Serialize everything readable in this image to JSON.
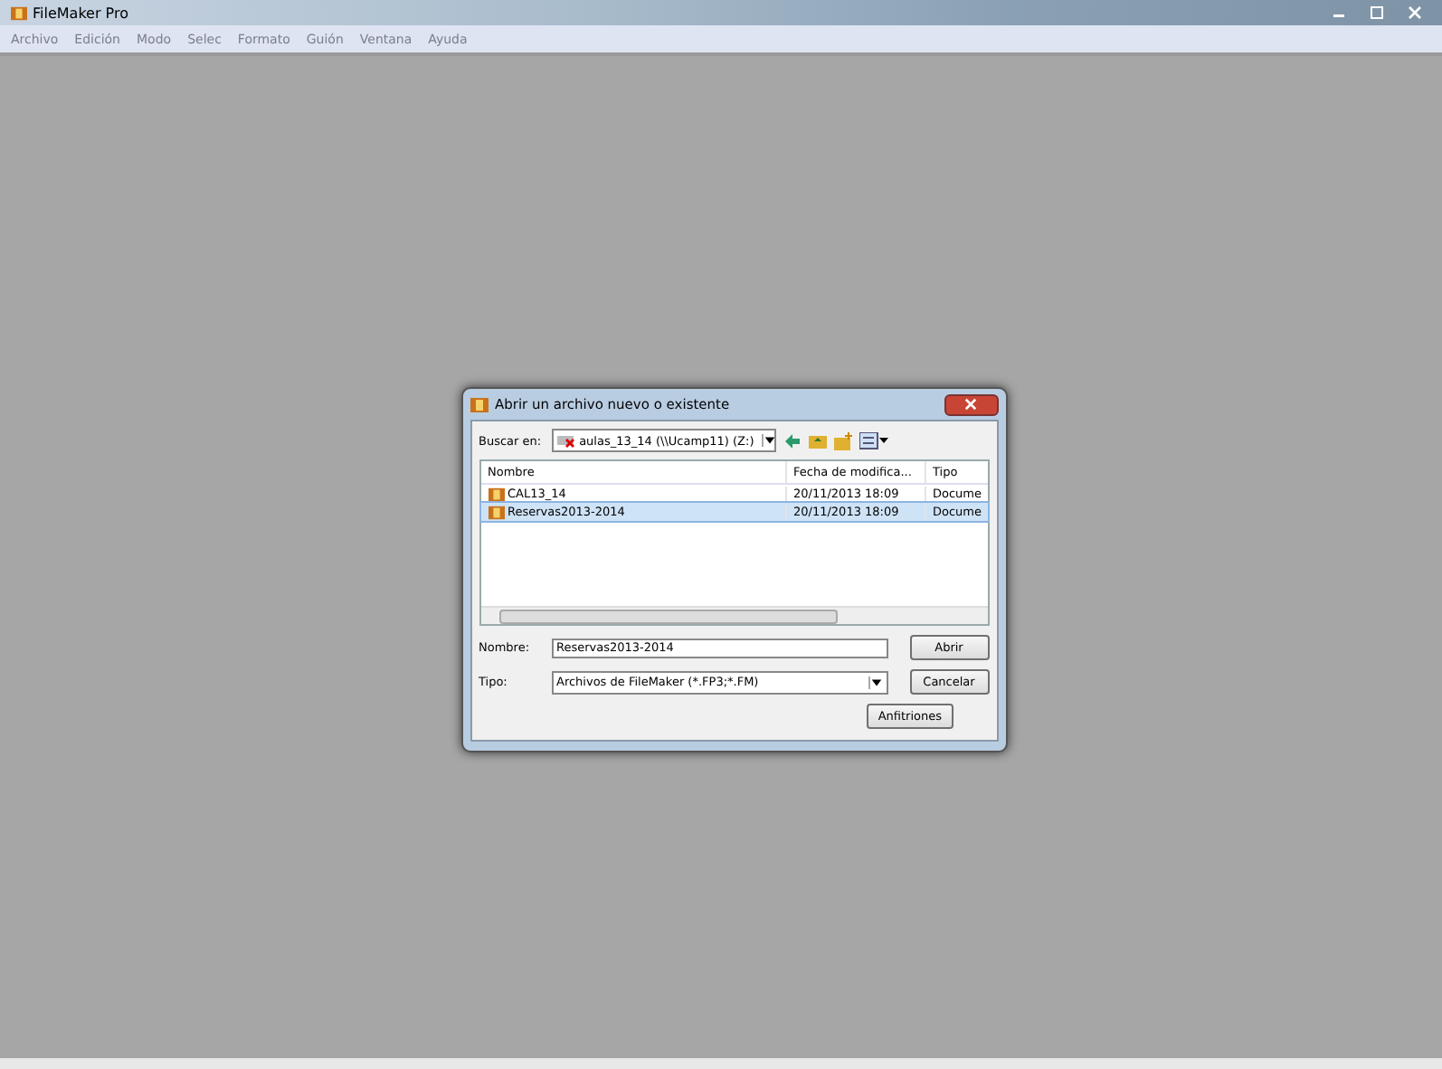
{
  "window": {
    "title": "FileMaker Pro"
  },
  "menu": [
    "Archivo",
    "Edición",
    "Modo",
    "Selec",
    "Formato",
    "Guión",
    "Ventana",
    "Ayuda"
  ],
  "dialog": {
    "title": "Abrir un archivo nuevo o existente",
    "look_in": {
      "label": "Buscar en:",
      "value": "aulas_13_14 (\\\\Ucamp11) (Z:)"
    },
    "columns": [
      "Nombre",
      "Fecha de modifica...",
      "Tipo"
    ],
    "files": [
      {
        "name": "CAL13_14",
        "date": "20/11/2013 18:09",
        "type": "Docume",
        "selected": false
      },
      {
        "name": "Reservas2013-2014",
        "date": "20/11/2013 18:09",
        "type": "Docume",
        "selected": true
      }
    ],
    "name_field": {
      "label": "Nombre:",
      "value": "Reservas2013-2014"
    },
    "type_field": {
      "label": "Tipo:",
      "value": "Archivos de FileMaker (*.FP3;*.FM)"
    },
    "buttons": [
      "Abrir",
      "Cancelar",
      "Anfitriones"
    ]
  }
}
